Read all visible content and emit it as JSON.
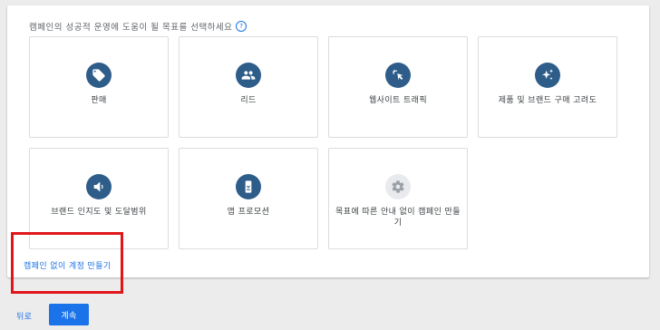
{
  "prompt": "캠페인의 성공적 운영에 도움이 될 목표를 선택하세요",
  "help_icon_glyph": "?",
  "tiles": [
    {
      "label": "판매",
      "icon": "tag-icon"
    },
    {
      "label": "리드",
      "icon": "people-icon"
    },
    {
      "label": "웹사이트 트래픽",
      "icon": "cursor-click-icon"
    },
    {
      "label": "제품 및 브랜드 구매 고려도",
      "icon": "sparkle-icon"
    },
    {
      "label": "브랜드 인지도 및 도달범위",
      "icon": "speaker-icon"
    },
    {
      "label": "앱 프로모션",
      "icon": "phone-download-icon"
    },
    {
      "label": "목표에 따른 안내 없이 캠페인 만들기",
      "icon": "gear-icon"
    }
  ],
  "link_text": "캠페인 없이 계정 만들기",
  "footer": {
    "back_label": "뒤로",
    "continue_label": "계속"
  },
  "colors": {
    "accent": "#1a73e8",
    "icon_bg": "#2e5d8a",
    "highlight_box": "#e0161b"
  }
}
